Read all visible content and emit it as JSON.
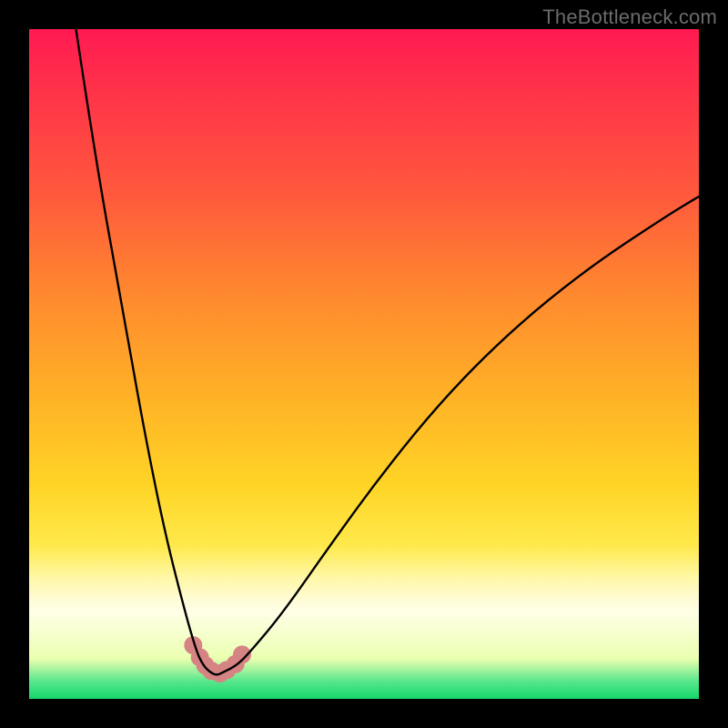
{
  "watermark": "TheBottleneck.com",
  "chart_data": {
    "type": "line",
    "title": "",
    "xlabel": "",
    "ylabel": "",
    "xlim": [
      0,
      100
    ],
    "ylim": [
      0,
      100
    ],
    "grid": false,
    "series": [
      {
        "name": "bottleneck-curve",
        "x": [
          7,
          10,
          14,
          17,
          20,
          23,
          25,
          26,
          27,
          28,
          29,
          31,
          33,
          38,
          45,
          53,
          62,
          72,
          83,
          95,
          100
        ],
        "values": [
          100,
          80,
          58,
          41,
          26,
          14,
          7,
          5,
          4,
          3.5,
          4,
          5,
          7,
          13,
          23,
          34,
          45,
          55,
          64,
          72,
          75
        ]
      }
    ],
    "trough_markers": {
      "x": [
        24.5,
        25.5,
        26.3,
        27.2,
        28.5,
        29.5,
        30.8,
        31.8
      ],
      "values": [
        8.0,
        6.2,
        5.0,
        4.2,
        3.8,
        4.3,
        5.2,
        6.6
      ],
      "color": "#d58383",
      "radius_px": 10
    },
    "colors": {
      "curve": "#000000",
      "background_top": "#ff1a52",
      "background_bottom": "#16d66a"
    }
  }
}
